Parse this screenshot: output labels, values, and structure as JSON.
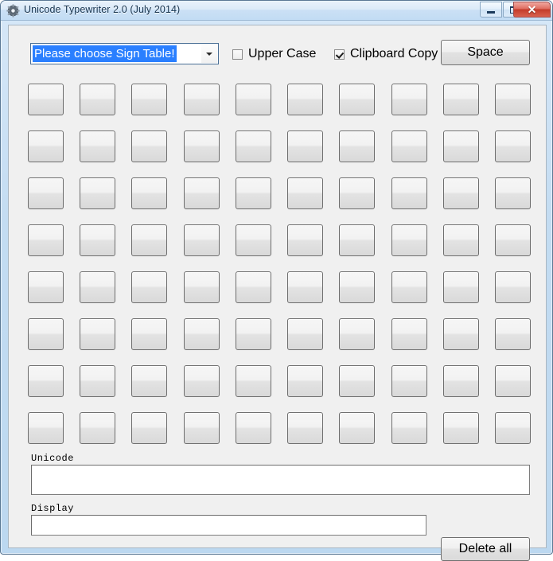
{
  "window": {
    "title": "Unicode Typewriter 2.0 (July 2014)",
    "icon": "gear-icon",
    "controls": {
      "minimize": "minimize-icon",
      "maximize": "maximize-icon",
      "close": "✕"
    }
  },
  "toolbar": {
    "sign_table_combo": {
      "selected": "Please choose Sign Table!",
      "caret": "chevron-down-icon"
    },
    "upper_case": {
      "label": "Upper Case",
      "checked": false
    },
    "clipboard_copy": {
      "label": "Clipboard Copy",
      "checked": true
    },
    "space_button": "Space"
  },
  "key_grid": {
    "columns": 10,
    "rows": 8,
    "keys": [
      [
        "",
        "",
        "",
        "",
        "",
        "",
        "",
        "",
        "",
        ""
      ],
      [
        "",
        "",
        "",
        "",
        "",
        "",
        "",
        "",
        "",
        ""
      ],
      [
        "",
        "",
        "",
        "",
        "",
        "",
        "",
        "",
        "",
        ""
      ],
      [
        "",
        "",
        "",
        "",
        "",
        "",
        "",
        "",
        "",
        ""
      ],
      [
        "",
        "",
        "",
        "",
        "",
        "",
        "",
        "",
        "",
        ""
      ],
      [
        "",
        "",
        "",
        "",
        "",
        "",
        "",
        "",
        "",
        ""
      ],
      [
        "",
        "",
        "",
        "",
        "",
        "",
        "",
        "",
        "",
        ""
      ],
      [
        "",
        "",
        "",
        "",
        "",
        "",
        "",
        "",
        "",
        ""
      ]
    ]
  },
  "fields": {
    "unicode": {
      "label": "Unicode",
      "value": "",
      "placeholder": ""
    },
    "display": {
      "label": "Display",
      "value": "",
      "placeholder": ""
    }
  },
  "actions": {
    "delete_all": "Delete all"
  },
  "colors": {
    "titlebar_text": "#15334f",
    "selection_blue": "#2a7fff",
    "close_red": "#c33a29",
    "client_bg": "#f0f0f0",
    "frame_blue": "#bcd8f0"
  }
}
